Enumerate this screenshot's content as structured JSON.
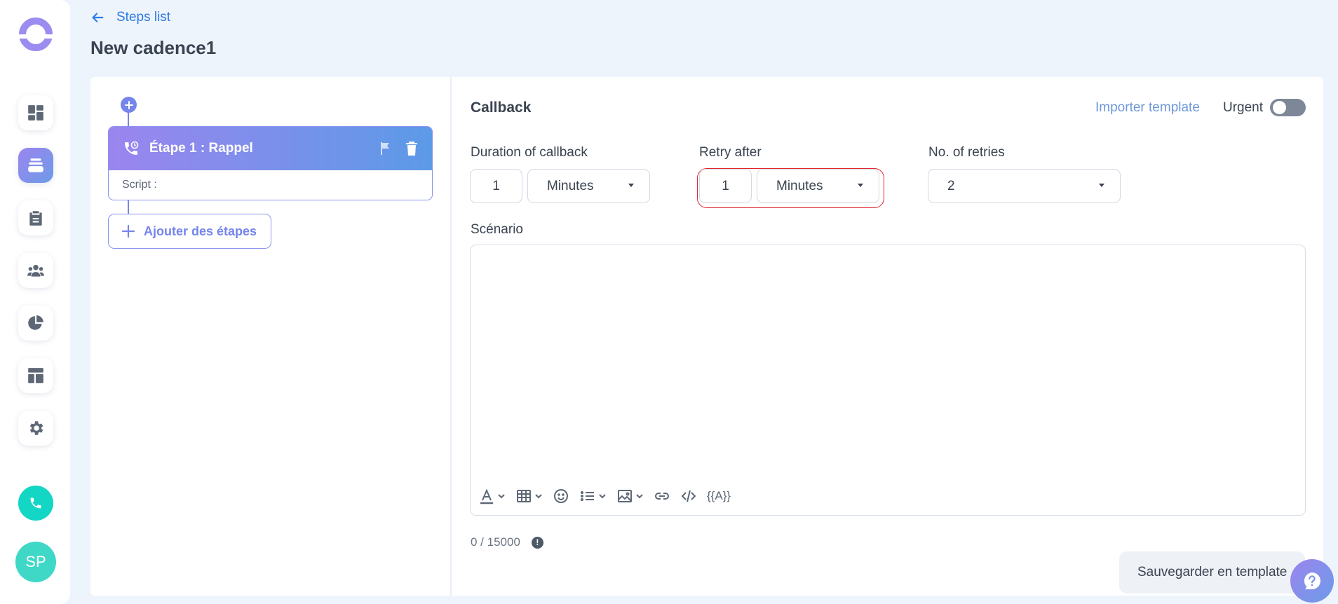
{
  "header": {
    "back_label": "Steps list",
    "title": "New cadence1"
  },
  "sidebar": {
    "items": [
      {
        "name": "dashboard-icon"
      },
      {
        "name": "cadence-icon",
        "active": true
      },
      {
        "name": "clipboard-icon"
      },
      {
        "name": "team-icon"
      },
      {
        "name": "pie-chart-icon"
      },
      {
        "name": "layout-icon"
      },
      {
        "name": "gear-icon"
      }
    ],
    "avatar_initials": "SP"
  },
  "steps": {
    "items": [
      {
        "title": "Étape 1 : Rappel",
        "script_label": "Script :"
      }
    ],
    "add_label": "Ajouter des étapes"
  },
  "callback": {
    "title": "Callback",
    "import_label": "Importer template",
    "urgent_label": "Urgent",
    "urgent_on": false,
    "duration": {
      "label": "Duration of callback",
      "value": "1",
      "unit": "Minutes"
    },
    "retry": {
      "label": "Retry after",
      "value": "1",
      "unit": "Minutes"
    },
    "retries": {
      "label": "No. of retries",
      "value": "2"
    },
    "scenario_label": "Scénario",
    "variable_token": "{{A}}",
    "counter": "0 / 15000",
    "save_label": "Sauvegarder en template"
  },
  "colors": {
    "accent": "#7585ec",
    "link": "#2c7be5",
    "error": "#e0242b",
    "phone": "#13d6c4"
  }
}
